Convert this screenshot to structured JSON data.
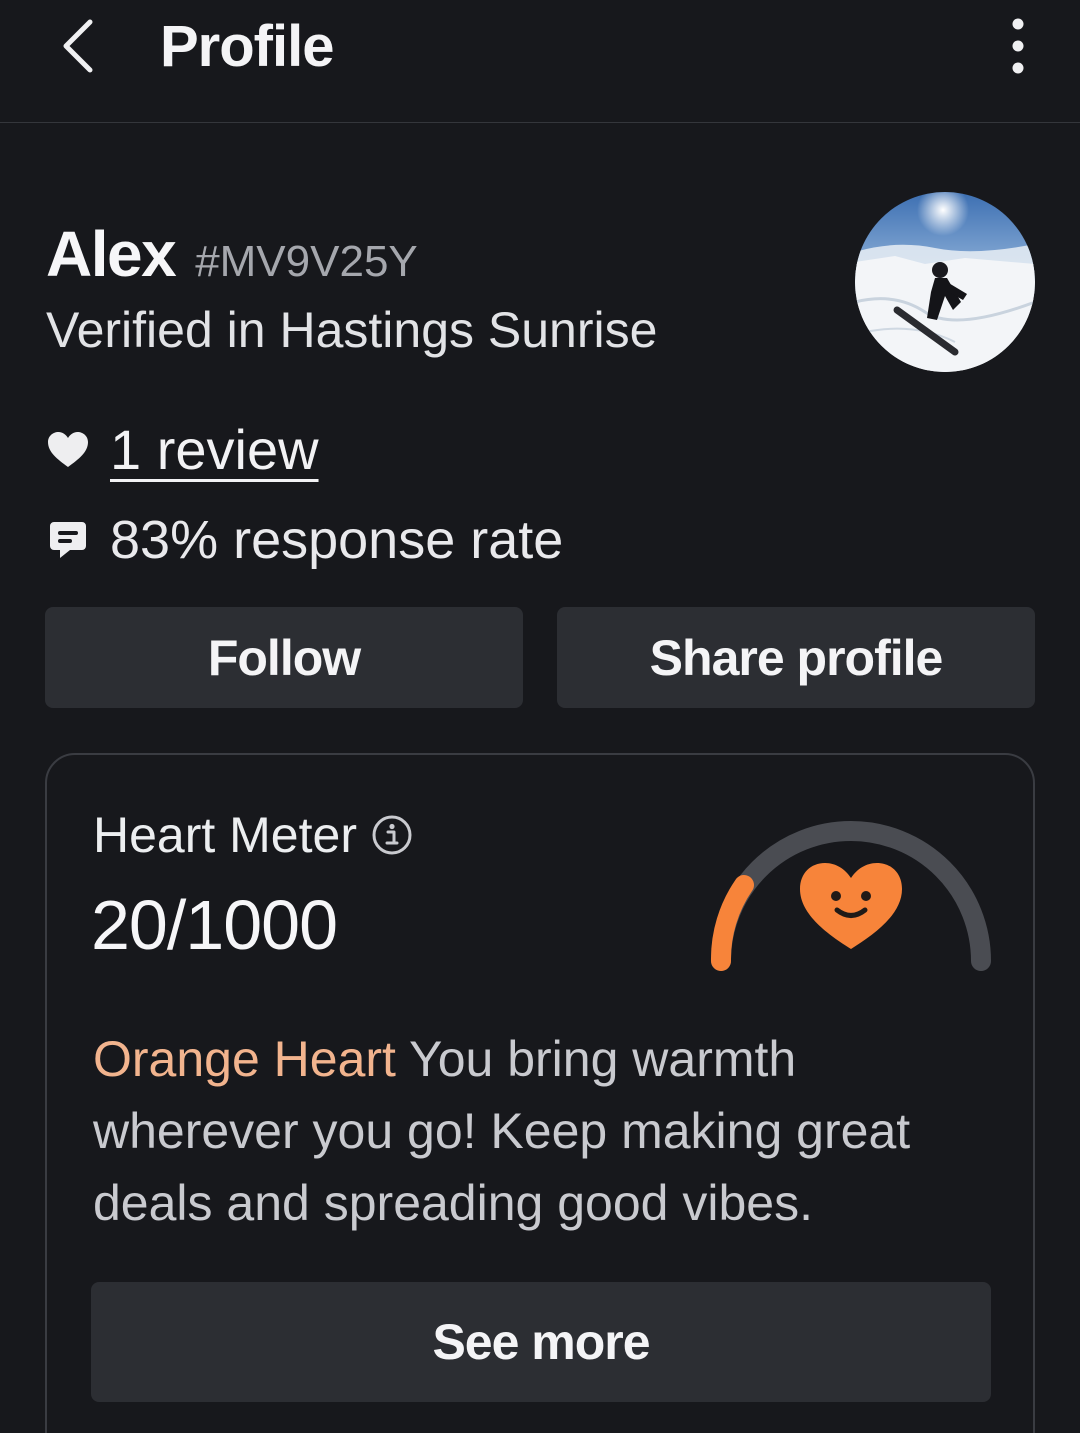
{
  "header": {
    "title": "Profile",
    "back_icon": "chevron-left-icon",
    "more_icon": "more-vertical-icon"
  },
  "profile": {
    "name": "Alex",
    "tag": "#MV9V25Y",
    "verified": "Verified in Hastings Sunrise",
    "reviews": "1 review",
    "response_rate": "83% response rate"
  },
  "actions": {
    "follow": "Follow",
    "share": "Share profile"
  },
  "heart_meter": {
    "label": "Heart Meter",
    "value": "20/1000",
    "score": 20,
    "max": 1000,
    "level": "Orange Heart",
    "message": "You bring warmth wherever you go! Keep making great deals and spreading good vibes.",
    "see_more": "See more"
  },
  "colors": {
    "background": "#17181c",
    "button": "#2c2e33",
    "accent_orange": "#f7843a",
    "level_text": "#f2b48e",
    "gauge_track": "#4a4c52"
  }
}
